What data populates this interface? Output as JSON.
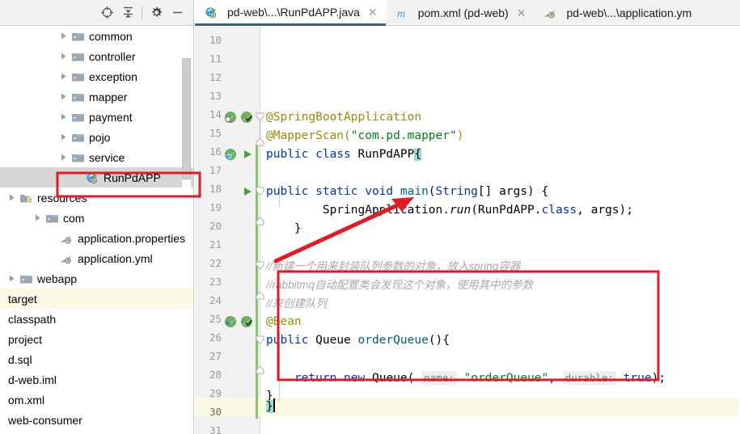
{
  "panel": {
    "toolbar_buttons": [
      {
        "name": "locate-icon",
        "title": "Select Opened File"
      },
      {
        "name": "collapse-all-icon",
        "title": "Collapse All"
      },
      {
        "name": "gear-icon",
        "title": "Settings"
      },
      {
        "name": "minimize-icon",
        "title": "Hide"
      }
    ],
    "tree": [
      {
        "label": "common",
        "icon": "folder-icon",
        "arrow": true,
        "indent": 72,
        "state": "normal"
      },
      {
        "label": "controller",
        "icon": "folder-icon",
        "arrow": true,
        "indent": 72,
        "state": "normal"
      },
      {
        "label": "exception",
        "icon": "folder-icon",
        "arrow": true,
        "indent": 72,
        "state": "normal"
      },
      {
        "label": "mapper",
        "icon": "folder-icon",
        "arrow": true,
        "indent": 72,
        "state": "normal"
      },
      {
        "label": "payment",
        "icon": "folder-icon",
        "arrow": true,
        "indent": 72,
        "state": "normal"
      },
      {
        "label": "pojo",
        "icon": "folder-icon",
        "arrow": true,
        "indent": 72,
        "state": "normal"
      },
      {
        "label": "service",
        "icon": "folder-icon",
        "arrow": true,
        "indent": 72,
        "state": "normal"
      },
      {
        "label": "RunPdAPP",
        "icon": "java-class-run-icon",
        "arrow": false,
        "indent": 90,
        "state": "selected"
      },
      {
        "label": "resources",
        "icon": "resources-folder-icon",
        "arrow": true,
        "indent": 8,
        "state": "normal"
      },
      {
        "label": "com",
        "icon": "folder-icon",
        "arrow": true,
        "indent": 40,
        "state": "normal"
      },
      {
        "label": "application.properties",
        "icon": "spring-config-icon",
        "arrow": false,
        "indent": 58,
        "state": "normal"
      },
      {
        "label": "application.yml",
        "icon": "spring-config-icon",
        "arrow": false,
        "indent": 58,
        "state": "normal"
      },
      {
        "label": "webapp",
        "icon": "folder-icon",
        "arrow": true,
        "indent": 8,
        "state": "normal"
      },
      {
        "label": "target",
        "icon": "none",
        "arrow": false,
        "indent": -6,
        "state": "cream"
      },
      {
        "label": "classpath",
        "icon": "none",
        "arrow": false,
        "indent": -6,
        "state": "normal"
      },
      {
        "label": "project",
        "icon": "none",
        "arrow": false,
        "indent": -6,
        "state": "normal"
      },
      {
        "label": "d.sql",
        "icon": "none",
        "arrow": false,
        "indent": -6,
        "state": "normal"
      },
      {
        "label": "d-web.iml",
        "icon": "none",
        "arrow": false,
        "indent": -6,
        "state": "normal"
      },
      {
        "label": "om.xml",
        "icon": "none",
        "arrow": false,
        "indent": -6,
        "state": "normal"
      },
      {
        "label": "web-consumer",
        "icon": "none",
        "arrow": false,
        "indent": -6,
        "state": "normal"
      }
    ]
  },
  "tabs": [
    {
      "label": "pd-web\\...\\RunPdAPP.java",
      "icon": "java-class-run-icon",
      "active": true,
      "close": "✕"
    },
    {
      "label": "pom.xml (pd-web)",
      "icon": "maven-icon",
      "active": false,
      "close": "✕"
    },
    {
      "label": "pd-web\\...\\application.ym",
      "icon": "spring-config-icon",
      "active": false,
      "close": ""
    }
  ],
  "editor": {
    "first_line": 10,
    "last_line": 31,
    "caret_line": 30,
    "line_numbers": [
      10,
      11,
      12,
      13,
      14,
      15,
      16,
      17,
      18,
      19,
      20,
      21,
      22,
      23,
      24,
      25,
      26,
      27,
      28,
      29,
      30,
      31
    ],
    "code": {
      "l13": "@SpringBootApplication",
      "l14_anno": "@MapperScan(",
      "l14_str": "\"com.pd.mapper\"",
      "l14_end": ")",
      "l15_kw1": "public",
      "l15_kw2": "class",
      "l15_name": "RunPdAPP",
      "l15_brace": "{",
      "l17": "    public static void main(String[] args) {",
      "l18": "        SpringApplication.run(RunPdAPP.class, args);",
      "l19": "    }",
      "l21_comment": "//新建一个用来封装队列参数的对象，放入spring容器",
      "l22_comment": "//rabbitmq自动配置类会发现这个对象，使用其中的参数",
      "l23_comment": "//来创建队列",
      "l24": "@Bean",
      "l25_kw1": "public",
      "l25_type": "Queue",
      "l25_method": "orderQueue",
      "l25_tail": "(){",
      "l27_kw1": "return",
      "l27_kw2": "new",
      "l27_type": "Queue",
      "l27_hint_name": "name:",
      "l27_str": "\"orderQueue\"",
      "l27_hint_durable": "durable:",
      "l27_kw3": "true",
      "l27_tail": ");",
      "l28": "}",
      "l30": "}"
    }
  },
  "annotations": {
    "arrow_color": "#e01b24",
    "box_color": "#e01b24",
    "selection_box_color": "#e01b24"
  },
  "colors": {
    "keyword": "#0033b3",
    "annotation": "#9e880d",
    "string": "#067d17",
    "comment": "#a8a8a8",
    "caret_line_bg": "#fbf8e3",
    "tab_active_underline": "#3d6185",
    "tree_selection_bg": "#d6d6d6"
  }
}
